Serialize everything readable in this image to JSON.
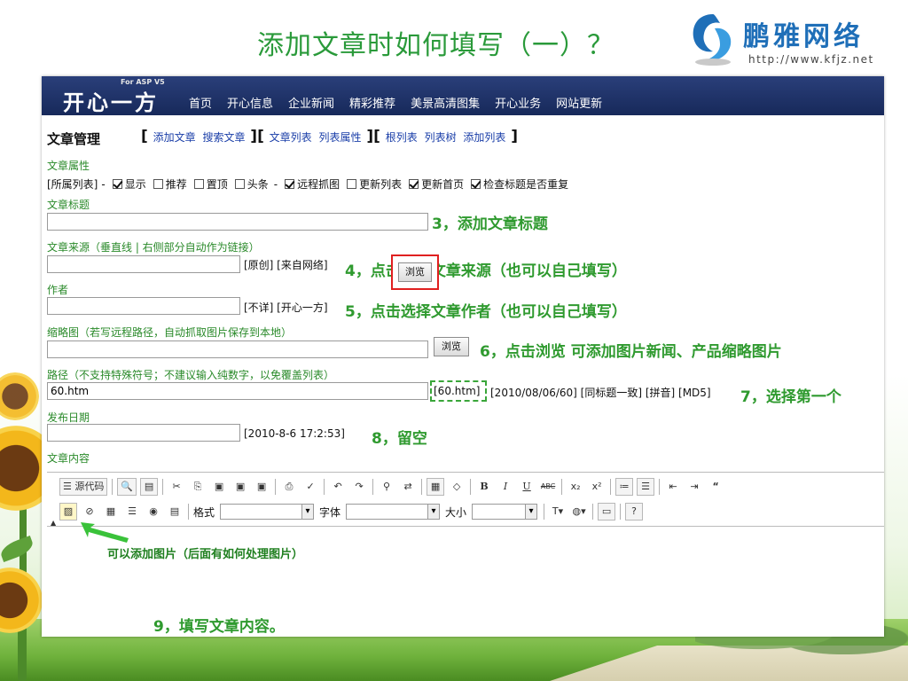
{
  "slide": {
    "title": "添加文章时如何填写（一）？",
    "logo_text": "鹏雅网络",
    "logo_url": "http://www.kfjz.net"
  },
  "site": {
    "sub": "For ASP V5",
    "logo": "开心一方",
    "nav": [
      "首页",
      "开心信息",
      "企业新闻",
      "精彩推荐",
      "美景高清图集",
      "开心业务",
      "网站更新"
    ]
  },
  "mgmt": {
    "title": "文章管理",
    "group1": [
      "添加文章",
      "搜索文章"
    ],
    "group2": [
      "文章列表",
      "列表属性"
    ],
    "group3": [
      "根列表",
      "列表树",
      "添加列表"
    ]
  },
  "attrs": {
    "label": "文章属性",
    "prefix": "[所属列表]",
    "items": [
      {
        "label": "显示",
        "checked": true
      },
      {
        "label": "推荐",
        "checked": false
      },
      {
        "label": "置顶",
        "checked": false
      },
      {
        "label": "头条",
        "checked": false
      },
      {
        "label": "远程抓图",
        "checked": true
      },
      {
        "label": "更新列表",
        "checked": false
      },
      {
        "label": "更新首页",
        "checked": true
      },
      {
        "label": "检查标题是否重复",
        "checked": true
      }
    ]
  },
  "form": {
    "title_label": "文章标题",
    "title_value": "",
    "source_label": "文章来源（垂直线 | 右侧部分自动作为链接）",
    "source_value": "",
    "source_options": "[原创] [来自网络]",
    "author_label": "作者",
    "author_value": "",
    "author_options": "[不详] [开心一方]",
    "thumb_label": "缩略图（若写远程路径，自动抓取图片保存到本地）",
    "thumb_value": "",
    "browse": "浏览",
    "path_label": "路径（不支持特殊符号；不建议输入纯数字，以免覆盖列表）",
    "path_value": "60.htm",
    "path_option_first": "[60.htm]",
    "path_options_rest": "[2010/08/06/60] [同标题一致] [拼音] [MD5]",
    "date_label": "发布日期",
    "date_value": "",
    "date_option": "[2010-8-6 17:2:53]",
    "content_label": "文章内容"
  },
  "annotations": {
    "a3": "3，添加文章标题",
    "a4": "4，点击选择文章来源（也可以自己填写）",
    "a5": "5，点击选择文章作者（也可以自己填写）",
    "a6": "6，点击浏览  可添加图片新闻、产品缩略图片",
    "a7": "7，选择第一个",
    "a8": "8，留空",
    "img_note": "可以添加图片（后面有如何处理图片）",
    "a9": "9，填写文章内容。"
  },
  "editor": {
    "source_code": "源代码",
    "format_label": "格式",
    "font_label": "字体",
    "size_label": "大小",
    "toolbar_row1": [
      "search-preview",
      "templates",
      "cut",
      "copy",
      "paste",
      "paste-text",
      "paste-word",
      "print",
      "spellcheck",
      "undo",
      "redo",
      "find",
      "replace",
      "select-all",
      "remove-format",
      "B",
      "I",
      "U",
      "ABC",
      "x₂",
      "x²",
      "ol",
      "ul",
      "outdent",
      "indent",
      "“"
    ],
    "toolbar_row2": [
      "image",
      "flash",
      "table",
      "hr",
      "smiley",
      "special-char"
    ]
  },
  "colors": {
    "title_green": "#2a9a3a",
    "annotation_green": "#2f9a2f",
    "header_navy": "#1c2f66",
    "highlight_red": "#e02020"
  }
}
